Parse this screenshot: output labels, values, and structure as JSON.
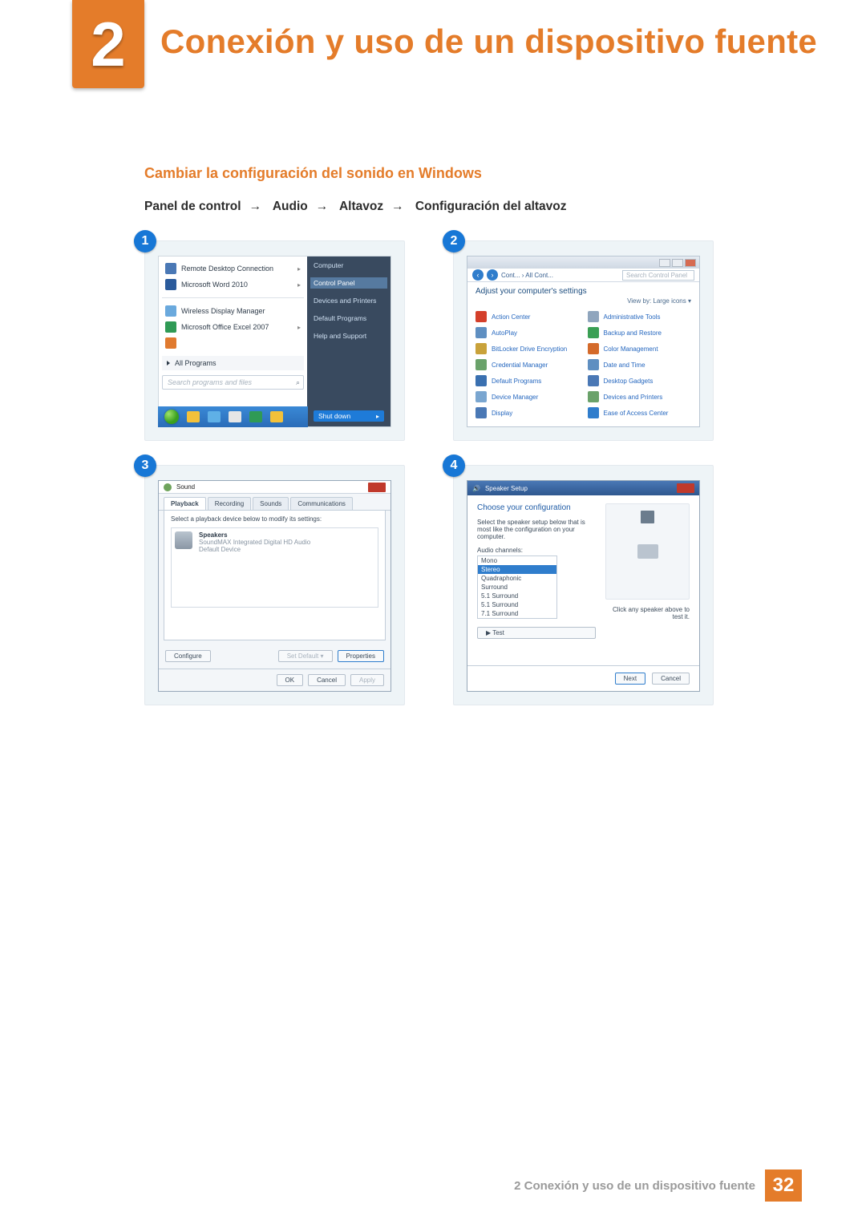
{
  "doc": {
    "chapter_number": "2",
    "chapter_title": "Conexión y uso de un dispositivo fuente",
    "section_heading": "Cambiar la configuración del sonido en Windows",
    "path": [
      "Panel de control",
      "Audio",
      "Altavoz",
      "Configuración del altavoz"
    ],
    "footer_label": "2 Conexión y uso de un dispositivo fuente",
    "page_number": "32"
  },
  "steps": [
    "1",
    "2",
    "3",
    "4"
  ],
  "start_menu": {
    "programs": [
      {
        "label": "Remote Desktop Connection",
        "caret": "▸"
      },
      {
        "label": "Microsoft Word 2010",
        "caret": "▸"
      },
      {
        "label": "Wireless Display Manager",
        "caret": ""
      },
      {
        "label": "Microsoft Office Excel 2007",
        "caret": "▸"
      }
    ],
    "all_programs": "All Programs",
    "search_placeholder": "Search programs and files",
    "right": [
      "Computer",
      "Control Panel",
      "Devices and Printers",
      "Default Programs",
      "Help and Support"
    ],
    "shutdown": "Shut down"
  },
  "control_panel": {
    "breadcrumb": "Cont... › All Cont...",
    "search_placeholder": "Search Control Panel",
    "heading": "Adjust your computer's settings",
    "viewby": "View by:  Large icons ▾",
    "items_left": [
      "Action Center",
      "AutoPlay",
      "BitLocker Drive Encryption",
      "Credential Manager",
      "Default Programs",
      "Device Manager",
      "Display"
    ],
    "items_right": [
      "Administrative Tools",
      "Backup and Restore",
      "Color Management",
      "Date and Time",
      "Desktop Gadgets",
      "Devices and Printers",
      "Ease of Access Center"
    ]
  },
  "sound_dialog": {
    "title": "Sound",
    "tabs": [
      "Playback",
      "Recording",
      "Sounds",
      "Communications"
    ],
    "instruction": "Select a playback device below to modify its settings:",
    "device": {
      "name": "Speakers",
      "sub1": "SoundMAX Integrated Digital HD Audio",
      "sub2": "Default Device"
    },
    "configure": "Configure",
    "set_default": "Set Default ▾",
    "properties": "Properties",
    "ok": "OK",
    "cancel": "Cancel",
    "apply": "Apply"
  },
  "speaker_setup": {
    "title": "Speaker Setup",
    "heading": "Choose your configuration",
    "instruction": "Select the speaker setup below that is most like the configuration on your computer.",
    "channels_label": "Audio channels:",
    "channels": [
      "Mono",
      "Stereo",
      "Quadraphonic",
      "Surround",
      "5.1 Surround",
      "5.1 Surround",
      "7.1 Surround"
    ],
    "selected": "Stereo",
    "test": "▶ Test",
    "tip": "Click any speaker above to test it.",
    "next": "Next",
    "cancel": "Cancel"
  }
}
